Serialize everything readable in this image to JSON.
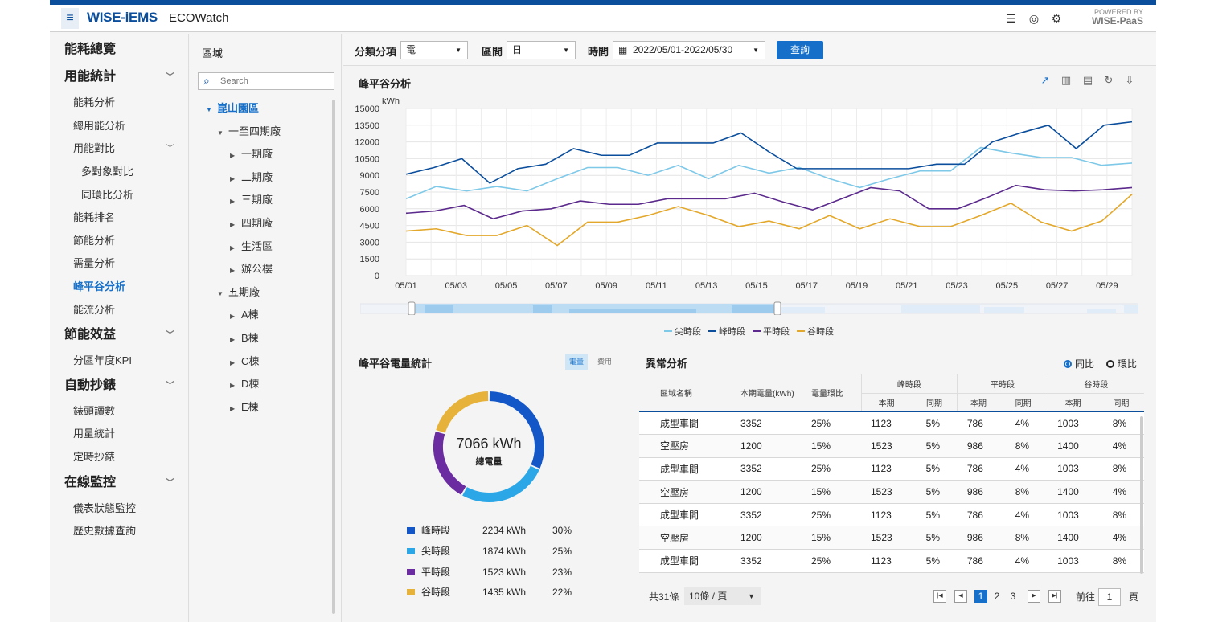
{
  "header": {
    "menu_icon": "hamburger-icon",
    "logo": "WISE-iEMS",
    "app_name": "ECOWatch",
    "powered_by": "POWERED BY",
    "powered_brand": "WISE-PaaS",
    "icons": [
      "sliders-icon",
      "user-icon",
      "gear-icon"
    ]
  },
  "sidebar": {
    "items": [
      {
        "label": "能耗總覽",
        "level": 1
      },
      {
        "label": "用能統計",
        "level": 1,
        "chevron": true
      },
      {
        "label": "能耗分析",
        "level": 2
      },
      {
        "label": "總用能分析",
        "level": 2
      },
      {
        "label": "用能對比",
        "level": 2,
        "chevron": true
      },
      {
        "label": "多對象對比",
        "level": 3
      },
      {
        "label": "同環比分析",
        "level": 3
      },
      {
        "label": "能耗排名",
        "level": 2
      },
      {
        "label": "節能分析",
        "level": 2
      },
      {
        "label": "需量分析",
        "level": 2
      },
      {
        "label": "峰平谷分析",
        "level": 2,
        "active": true
      },
      {
        "label": "能流分析",
        "level": 2
      },
      {
        "label": "節能效益",
        "level": 1,
        "chevron": true
      },
      {
        "label": "分區年度KPI",
        "level": 2
      },
      {
        "label": "自動抄錶",
        "level": 1,
        "chevron": true
      },
      {
        "label": "錶頭讀數",
        "level": 2
      },
      {
        "label": "用量統計",
        "level": 2
      },
      {
        "label": "定時抄錶",
        "level": 2
      },
      {
        "label": "在線監控",
        "level": 1,
        "chevron": true
      },
      {
        "label": "儀表狀態監控",
        "level": 2
      },
      {
        "label": "歷史數據查詢",
        "level": 2
      }
    ]
  },
  "tree": {
    "title": "區域",
    "search_placeholder": "Search",
    "nodes": [
      {
        "label": "崑山園區",
        "depth": 0,
        "open": true,
        "selected": true
      },
      {
        "label": "一至四期廠",
        "depth": 1,
        "open": true
      },
      {
        "label": "一期廠",
        "depth": 2
      },
      {
        "label": "二期廠",
        "depth": 2
      },
      {
        "label": "三期廠",
        "depth": 2
      },
      {
        "label": "四期廠",
        "depth": 2
      },
      {
        "label": "生活區",
        "depth": 2
      },
      {
        "label": "辦公樓",
        "depth": 2
      },
      {
        "label": "五期廠",
        "depth": 1,
        "open": true
      },
      {
        "label": "A棟",
        "depth": 2
      },
      {
        "label": "B棟",
        "depth": 2
      },
      {
        "label": "C棟",
        "depth": 2
      },
      {
        "label": "D棟",
        "depth": 2
      },
      {
        "label": "E棟",
        "depth": 2
      }
    ]
  },
  "filters": {
    "category_label": "分類分項",
    "category_value": "電",
    "interval_label": "區間",
    "interval_value": "日",
    "time_label": "時間",
    "time_value": "2022/05/01-2022/05/30",
    "query_button": "查詢"
  },
  "line_panel": {
    "title": "峰平谷分析",
    "toolbar_icons": [
      "trend-line-icon",
      "bar-chart-icon",
      "table-view-icon",
      "refresh-icon",
      "download-icon"
    ]
  },
  "chart_data": [
    {
      "type": "line",
      "title": "峰平谷分析",
      "ylabel": "kWh",
      "ylim": [
        0,
        15000
      ],
      "yticks": [
        0,
        1500,
        3000,
        4500,
        6000,
        7500,
        9000,
        10500,
        12000,
        13500,
        15000
      ],
      "x": [
        "05/01",
        "05/02",
        "05/03",
        "05/04",
        "05/05",
        "05/06",
        "05/07",
        "05/08",
        "05/09",
        "05/10",
        "05/11",
        "05/12",
        "05/13",
        "05/14",
        "05/15",
        "05/16",
        "05/17",
        "05/18",
        "05/19",
        "05/20",
        "05/21",
        "05/22",
        "05/23",
        "05/24",
        "05/25",
        "05/26",
        "05/27",
        "05/28",
        "05/29",
        "05/30"
      ],
      "xtick_labels": [
        "05/01",
        "05/03",
        "05/05",
        "05/07",
        "05/09",
        "05/11",
        "05/13",
        "05/15",
        "05/17",
        "05/19",
        "05/21",
        "05/23",
        "05/25",
        "05/27",
        "05/29"
      ],
      "grid": true,
      "legend_position": "bottom",
      "series": [
        {
          "name": "尖時段",
          "color": "#7ec8e8",
          "values": [
            6900,
            8000,
            7600,
            8000,
            7600,
            8700,
            9700,
            9700,
            9000,
            9900,
            8700,
            9900,
            9200,
            9700,
            8700,
            7900,
            8700,
            9400,
            9400,
            11500,
            11000,
            10600,
            10600,
            9900,
            10100
          ]
        },
        {
          "name": "峰時段",
          "color": "#0b4e9c",
          "values": [
            9100,
            9700,
            10500,
            8300,
            9600,
            10000,
            11400,
            10800,
            10800,
            11900,
            11900,
            11900,
            12800,
            11100,
            9600,
            9600,
            9600,
            9600,
            9600,
            10000,
            10000,
            12000,
            12800,
            13500,
            11400,
            13500,
            13800
          ]
        },
        {
          "name": "平時段",
          "color": "#5b2a8c",
          "values": [
            5600,
            5800,
            6300,
            5100,
            5800,
            6000,
            6700,
            6400,
            6400,
            6900,
            6900,
            6900,
            7400,
            6600,
            5900,
            6900,
            7900,
            7600,
            6000,
            6000,
            7000,
            8100,
            7700,
            7600,
            7700,
            7900
          ]
        },
        {
          "name": "谷時段",
          "color": "#e3a82b",
          "values": [
            4000,
            4200,
            3600,
            3600,
            4500,
            2700,
            4800,
            4800,
            5400,
            6200,
            5400,
            4400,
            4900,
            4200,
            5400,
            4200,
            5100,
            4400,
            4400,
            5400,
            6500,
            4800,
            4000,
            4900,
            7300
          ]
        }
      ]
    },
    {
      "type": "pie",
      "title": "峰平谷電量統計",
      "center_value": "7066 kWh",
      "center_label": "總電量",
      "slices": [
        {
          "name": "峰時段",
          "value": 2234,
          "unit": "kWh",
          "percent": 30,
          "color": "#1256c8"
        },
        {
          "name": "尖時段",
          "value": 1874,
          "unit": "kWh",
          "percent": 25,
          "color": "#2ba7e8"
        },
        {
          "name": "平時段",
          "value": 1523,
          "unit": "kWh",
          "percent": 23,
          "color": "#6a2ca0"
        },
        {
          "name": "谷時段",
          "value": 1435,
          "unit": "kWh",
          "percent": 22,
          "color": "#e6b23a"
        }
      ]
    }
  ],
  "stats_panel": {
    "title": "峰平谷電量統計",
    "toggle_left": "電量",
    "toggle_right": "費用",
    "legend_values": [
      "2234 kWh",
      "1874 kWh",
      "1523 kWh",
      "1435 kWh"
    ],
    "legend_percents": [
      "30%",
      "25%",
      "23%",
      "22%"
    ]
  },
  "anomaly": {
    "title": "異常分析",
    "radio_yoy": "同比",
    "radio_mom": "環比",
    "headers": {
      "area": "區域名稱",
      "current": "本期電量(kWh)",
      "ratio": "電量環比",
      "peak": "峰時段",
      "flat": "平時段",
      "valley": "谷時段",
      "sub_current": "本期",
      "sub_same": "同期"
    },
    "rows": [
      [
        "成型車間",
        "3352",
        "25%",
        "1123",
        "5%",
        "786",
        "4%",
        "1003",
        "8%"
      ],
      [
        "空壓房",
        "1200",
        "15%",
        "1523",
        "5%",
        "986",
        "8%",
        "1400",
        "4%"
      ],
      [
        "成型車間",
        "3352",
        "25%",
        "1123",
        "5%",
        "786",
        "4%",
        "1003",
        "8%"
      ],
      [
        "空壓房",
        "1200",
        "15%",
        "1523",
        "5%",
        "986",
        "8%",
        "1400",
        "4%"
      ],
      [
        "成型車間",
        "3352",
        "25%",
        "1123",
        "5%",
        "786",
        "4%",
        "1003",
        "8%"
      ],
      [
        "空壓房",
        "1200",
        "15%",
        "1523",
        "5%",
        "986",
        "8%",
        "1400",
        "4%"
      ],
      [
        "成型車間",
        "3352",
        "25%",
        "1123",
        "5%",
        "786",
        "4%",
        "1003",
        "8%"
      ]
    ],
    "total": "共31條",
    "page_size": "10條 / 頁",
    "pages": [
      "1",
      "2",
      "3"
    ],
    "goto_label": "前往",
    "goto_value": "1",
    "page_suffix": "頁"
  }
}
